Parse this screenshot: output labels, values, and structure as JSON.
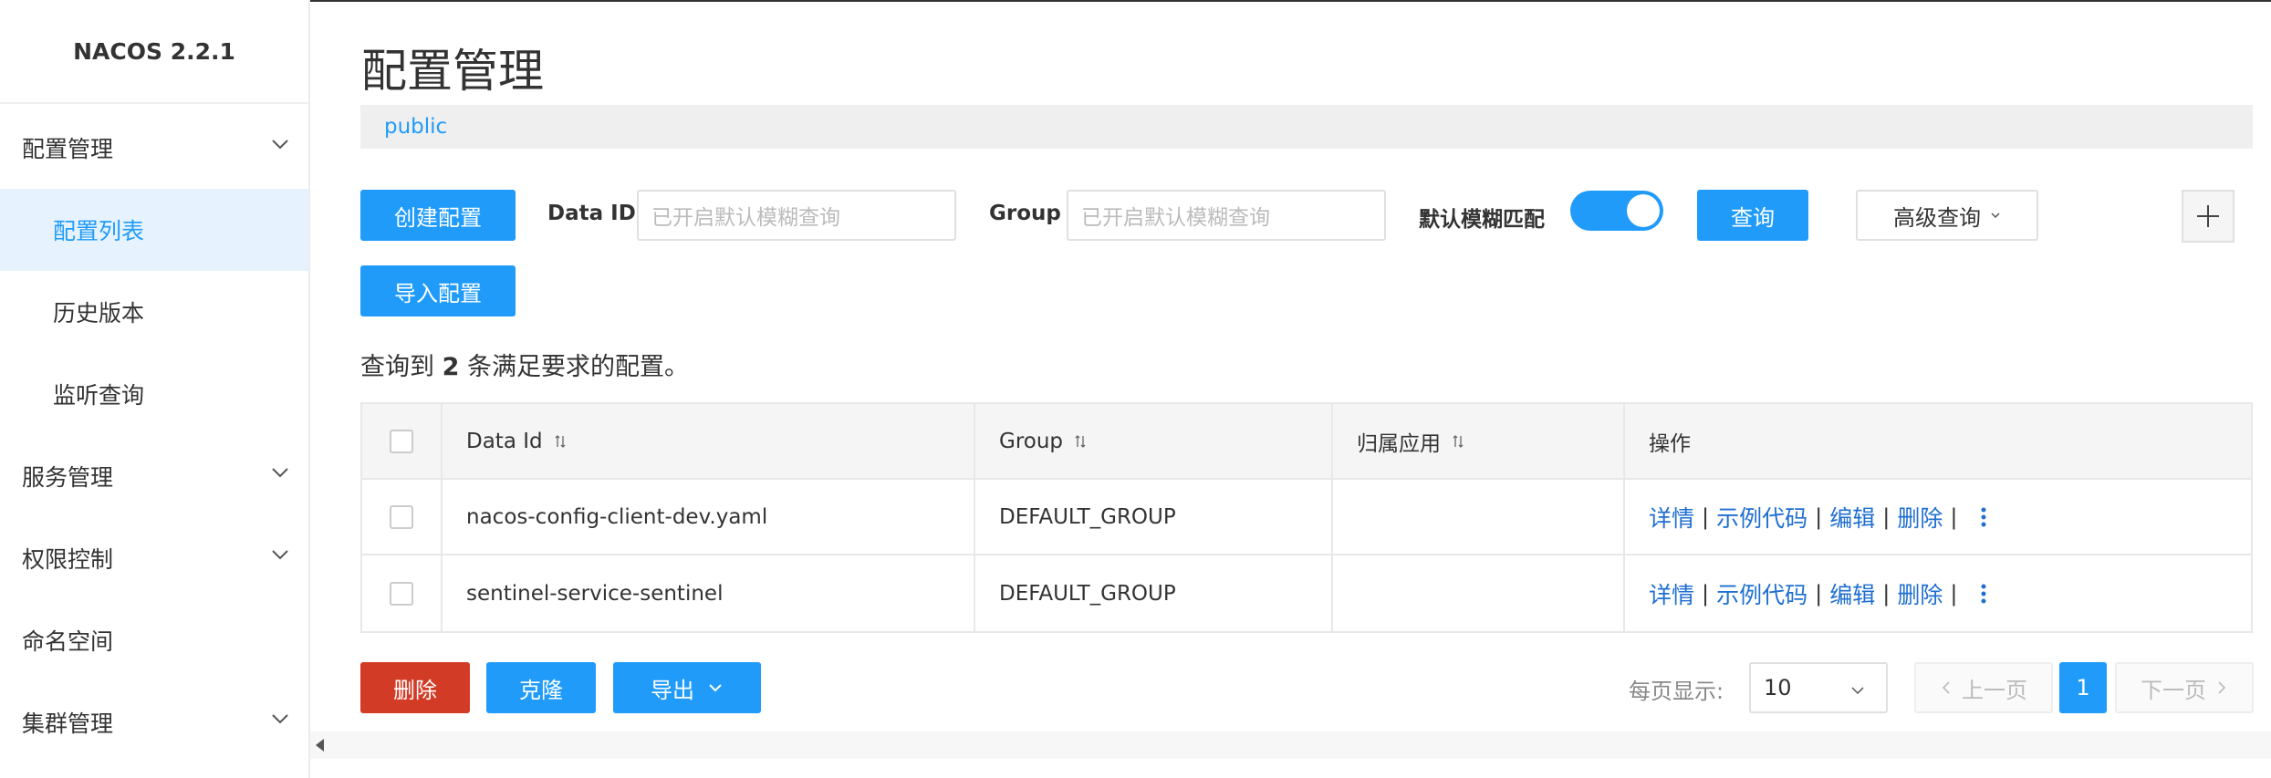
{
  "app": {
    "brand": "NACOS 2.2.1"
  },
  "sidebar": {
    "items": [
      {
        "label": "配置管理",
        "expandable": true
      },
      {
        "label": "配置列表",
        "active": true,
        "sub": true
      },
      {
        "label": "历史版本",
        "sub": true
      },
      {
        "label": "监听查询",
        "sub": true
      },
      {
        "label": "服务管理",
        "expandable": true
      },
      {
        "label": "权限控制",
        "expandable": true
      },
      {
        "label": "命名空间"
      },
      {
        "label": "集群管理",
        "expandable": true
      }
    ]
  },
  "main": {
    "title": "配置管理",
    "namespace": "public",
    "toolbar": {
      "create_label": "创建配置",
      "import_label": "导入配置",
      "dataid_label": "Data ID",
      "dataid_placeholder": "已开启默认模糊查询",
      "group_label": "Group",
      "group_placeholder": "已开启默认模糊查询",
      "fuzzy_label": "默认模糊匹配",
      "fuzzy_enabled": true,
      "query_label": "查询",
      "advanced_label": "高级查询"
    },
    "result": {
      "prefix": "查询到",
      "count": "2",
      "suffix": "条满足要求的配置。"
    },
    "table": {
      "columns": [
        "Data Id",
        "Group",
        "归属应用",
        "操作"
      ],
      "rows": [
        {
          "data_id": "nacos-config-client-dev.yaml",
          "group": "DEFAULT_GROUP",
          "app": ""
        },
        {
          "data_id": "sentinel-service-sentinel",
          "group": "DEFAULT_GROUP",
          "app": ""
        }
      ],
      "ops": {
        "detail": "详情",
        "sample": "示例代码",
        "edit": "编辑",
        "delete": "删除",
        "sep": "|"
      }
    },
    "footer": {
      "delete_label": "删除",
      "clone_label": "克隆",
      "export_label": "导出",
      "page_size_label": "每页显示:",
      "page_size": "10",
      "prev_label": "上一页",
      "next_label": "下一页",
      "current_page": "1"
    }
  },
  "colors": {
    "accent": "#209bfa",
    "danger": "#d23c26",
    "link": "#1f6fd1"
  }
}
